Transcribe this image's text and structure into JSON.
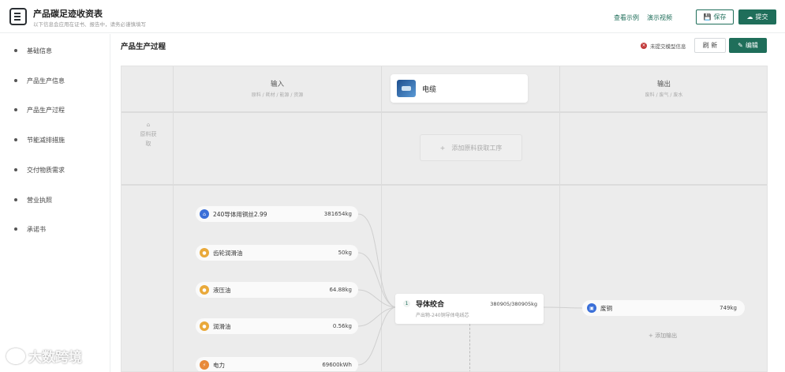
{
  "header": {
    "title": "产品碳足迹收资表",
    "subtitle": "以下信息会应用在证书、报告中，请务必谨慎填写",
    "link_example": "查看示例",
    "link_video": "演示视频",
    "save_label": "保存",
    "submit_label": "提交"
  },
  "sidebar": {
    "items": [
      {
        "label": "基础信息"
      },
      {
        "label": "产品生产信息"
      },
      {
        "label": "产品生产过程"
      },
      {
        "label": "节能减排措施"
      },
      {
        "label": "交付物质需求"
      },
      {
        "label": "营业执照"
      },
      {
        "label": "承诺书"
      }
    ]
  },
  "section": {
    "title": "产品生产过程",
    "warning": "未提交模型信息",
    "refresh_label": "刷 新",
    "edit_label": "编辑"
  },
  "canvas": {
    "input_header": "输入",
    "input_hint": "原料 / 耗材 / 能源 / 资源",
    "product_name": "电缆",
    "output_header": "输出",
    "output_hint": "废料 / 废气 / 废水",
    "stage_label": "原料获取",
    "add_step_label": "添加原料获取工序",
    "inputs": [
      {
        "name": "240导体用铜丝2.99",
        "amount": "381654kg",
        "icon": "factory-icon",
        "color": "#3a6fd8"
      },
      {
        "name": "齿轮润滑油",
        "amount": "50kg",
        "icon": "oil-icon",
        "color": "#e9a93a"
      },
      {
        "name": "液压油",
        "amount": "64.88kg",
        "icon": "oil-icon",
        "color": "#e9a93a"
      },
      {
        "name": "润滑油",
        "amount": "0.56kg",
        "icon": "oil-icon",
        "color": "#e9a93a"
      },
      {
        "name": "电力",
        "amount": "69600kWh",
        "icon": "power-icon",
        "color": "#e88a3a"
      }
    ],
    "process": {
      "number": "1",
      "name": "导体绞合",
      "ratio": "380905/380905kg",
      "description": "产出物-240铜导体电线芯"
    },
    "output": {
      "name": "废铜",
      "amount": "749kg",
      "icon": "waste-icon",
      "color": "#3a6fd8"
    },
    "add_output_label": "添加输出"
  },
  "watermark": "大数跨境"
}
